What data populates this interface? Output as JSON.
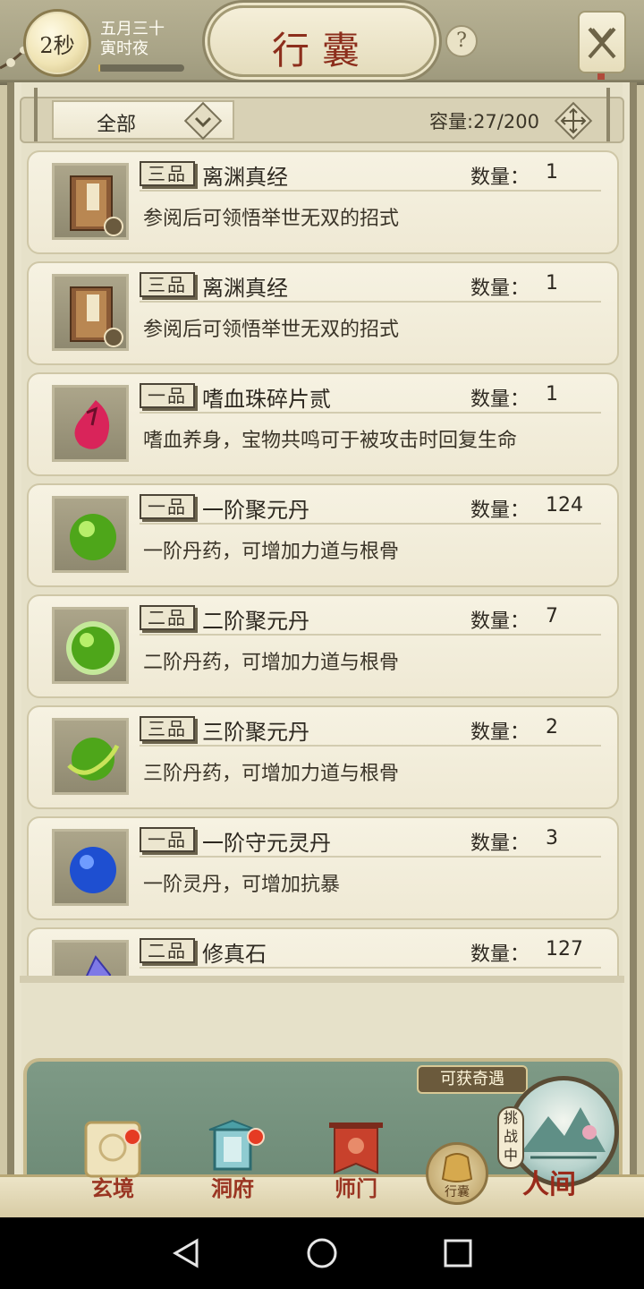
{
  "header": {
    "timer": "2秒",
    "date_line1": "五月三十",
    "date_line2": "寅时夜",
    "time_progress": 0.02,
    "title": "行囊",
    "help_icon": "question-icon",
    "close_icon": "close-icon"
  },
  "filter": {
    "selected": "全部",
    "capacity": "容量:27/200"
  },
  "items": [
    {
      "grade": "三品",
      "name": "离渊真经",
      "qty_label": "数量：",
      "qty": "1",
      "desc": "参阅后可领悟举世无双的招式",
      "icon": "book-icon"
    },
    {
      "grade": "三品",
      "name": "离渊真经",
      "qty_label": "数量：",
      "qty": "1",
      "desc": "参阅后可领悟举世无双的招式",
      "icon": "book-icon"
    },
    {
      "grade": "一品",
      "name": "嗜血珠碎片贰",
      "qty_label": "数量：",
      "qty": "1",
      "desc": "嗜血养身，宝物共鸣可于被攻击时回复生命",
      "icon": "blood-shard-icon"
    },
    {
      "grade": "一品",
      "name": "一阶聚元丹",
      "qty_label": "数量：",
      "qty": "124",
      "desc": "一阶丹药，可增加力道与根骨",
      "icon": "green-pill-icon"
    },
    {
      "grade": "二品",
      "name": "二阶聚元丹",
      "qty_label": "数量：",
      "qty": "7",
      "desc": "二阶丹药，可增加力道与根骨",
      "icon": "green-pill-glow-icon"
    },
    {
      "grade": "三品",
      "name": "三阶聚元丹",
      "qty_label": "数量：",
      "qty": "2",
      "desc": "三阶丹药，可增加力道与根骨",
      "icon": "green-pill-swirl-icon"
    },
    {
      "grade": "一品",
      "name": "一阶守元灵丹",
      "qty_label": "数量：",
      "qty": "3",
      "desc": "一阶灵丹，可增加抗暴",
      "icon": "blue-pill-icon"
    },
    {
      "grade": "二品",
      "name": "修真石",
      "qty_label": "数量：",
      "qty": "127",
      "desc": "",
      "icon": "crystal-icon"
    }
  ],
  "nav": {
    "tabs": [
      {
        "label": "玄境",
        "icon": "scroll-icon"
      },
      {
        "label": "洞府",
        "icon": "lantern-icon"
      },
      {
        "label": "师门",
        "icon": "banner-icon"
      }
    ],
    "bag_label": "行囊",
    "adventure_label": "可获奇遇",
    "challenge_label": "挑战中",
    "world_label": "人间"
  }
}
